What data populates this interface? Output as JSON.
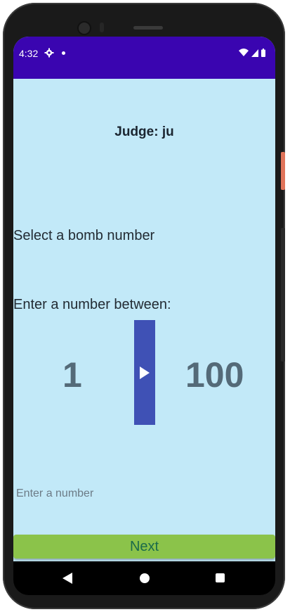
{
  "status_bar": {
    "time": "4:32",
    "icons": [
      "gear-icon",
      "notification-dot-icon",
      "wifi-icon",
      "signal-icon",
      "battery-icon"
    ]
  },
  "game": {
    "judge_title": "Judge: ju",
    "select_prompt": "Select a bomb number",
    "range_prompt": "Enter a number between:",
    "range_low": "1",
    "range_high": "100"
  },
  "input": {
    "value": "",
    "placeholder": "Enter a number"
  },
  "actions": {
    "next_label": "Next"
  },
  "colors": {
    "status_bar": "#3a05b0",
    "screen_background": "#c2e9f8",
    "range_arrow": "#3f51b5",
    "range_numbers": "#546a78",
    "next_button": "#8bc34a",
    "next_text": "#1b6b4a"
  }
}
